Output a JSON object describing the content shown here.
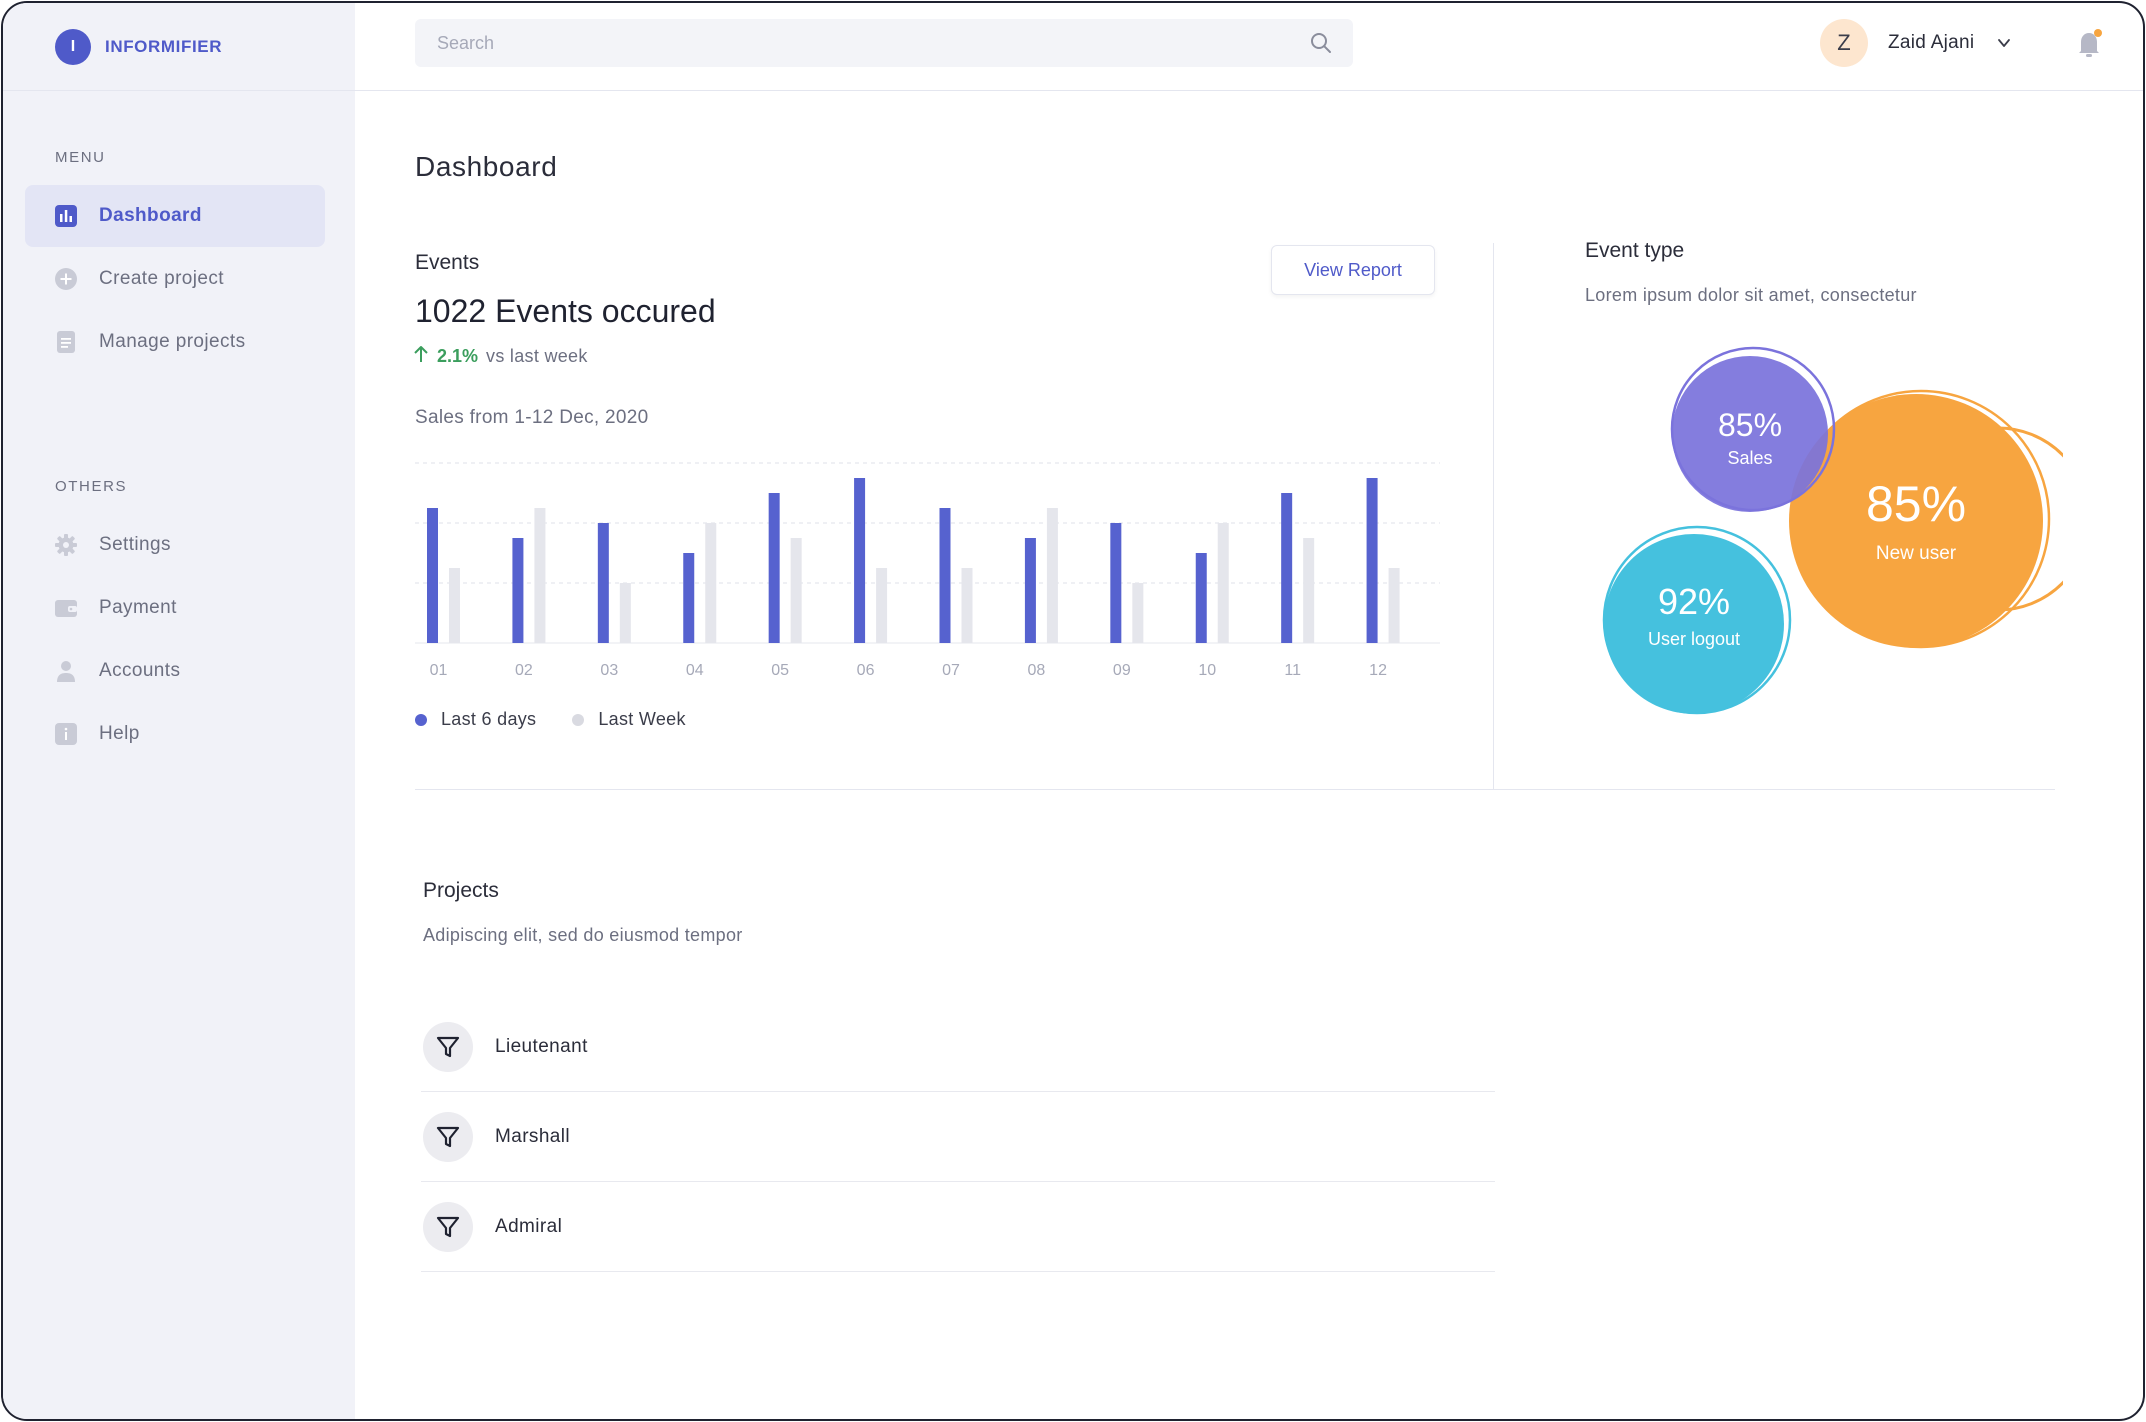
{
  "brand": {
    "logo_letter": "I",
    "name": "INFORMIFIER",
    "color": "#4f5ac9"
  },
  "search": {
    "placeholder": "Search"
  },
  "user": {
    "initial": "Z",
    "name": "Zaid Ajani"
  },
  "sidebar": {
    "menu_label": "MENU",
    "menu_items": [
      {
        "label": "Dashboard",
        "icon": "chart-icon",
        "active": true
      },
      {
        "label": "Create project",
        "icon": "plus-circle-icon",
        "active": false
      },
      {
        "label": "Manage projects",
        "icon": "document-icon",
        "active": false
      }
    ],
    "others_label": "OTHERS",
    "other_items": [
      {
        "label": "Settings",
        "icon": "gear-icon"
      },
      {
        "label": "Payment",
        "icon": "wallet-icon"
      },
      {
        "label": "Accounts",
        "icon": "user-icon"
      },
      {
        "label": "Help",
        "icon": "info-icon"
      }
    ]
  },
  "main": {
    "title": "Dashboard",
    "events": {
      "label": "Events",
      "count_text": "1022 Events occured",
      "trend_pct": "2.1%",
      "trend_text": "vs last week",
      "view_report": "View Report",
      "subtitle": "Sales from 1-12 Dec, 2020"
    },
    "event_type": {
      "title": "Event type",
      "subtitle": "Lorem ipsum dolor sit amet, consectetur",
      "bubbles": [
        {
          "value": "85%",
          "label": "Sales",
          "color": "#7b73dc"
        },
        {
          "value": "85%",
          "label": "New user",
          "color": "#f7a540"
        },
        {
          "value": "92%",
          "label": "User logout",
          "color": "#45c1de"
        }
      ]
    },
    "projects": {
      "title": "Projects",
      "subtitle": "Adipiscing elit, sed do eiusmod tempor",
      "items": [
        {
          "name": "Lieutenant",
          "icon": "filter-icon"
        },
        {
          "name": "Marshall",
          "icon": "filter-icon"
        },
        {
          "name": "Admiral",
          "icon": "filter-icon"
        }
      ]
    }
  },
  "chart_data": {
    "type": "bar",
    "categories": [
      "01",
      "02",
      "03",
      "04",
      "05",
      "06",
      "07",
      "08",
      "09",
      "10",
      "11",
      "12"
    ],
    "series": [
      {
        "name": "Last 6 days",
        "color": "#5662cf",
        "values": [
          9,
          7,
          8,
          6,
          10,
          11,
          9,
          7,
          8,
          6,
          10,
          11
        ]
      },
      {
        "name": "Last Week",
        "color": "#e5e6ec",
        "values": [
          5,
          9,
          4,
          8,
          7,
          5,
          5,
          9,
          4,
          8,
          7,
          5
        ]
      }
    ],
    "ylim": [
      0,
      12
    ],
    "grid": true,
    "legend": "bottom-left"
  }
}
